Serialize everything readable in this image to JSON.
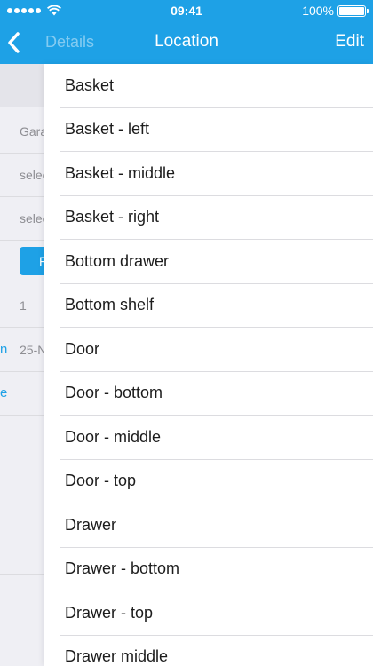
{
  "status_bar": {
    "time": "09:41",
    "battery": "100%"
  },
  "nav": {
    "back_title": "Details",
    "title": "Location",
    "edit_label": "Edit"
  },
  "background": {
    "cells": [
      "Gara",
      "selec",
      "selec",
      "F",
      "1",
      "25-N"
    ],
    "left_text_1": "n",
    "left_text_2": "e"
  },
  "locations": [
    "Basket",
    "Basket - left",
    "Basket - middle",
    "Basket - right",
    "Bottom drawer",
    "Bottom shelf",
    "Door",
    "Door - bottom",
    "Door - middle",
    "Door - top",
    "Drawer",
    "Drawer - bottom",
    "Drawer - top",
    "Drawer middle"
  ],
  "colors": {
    "accent": "#1ea1e6",
    "background": "#efeff4"
  }
}
